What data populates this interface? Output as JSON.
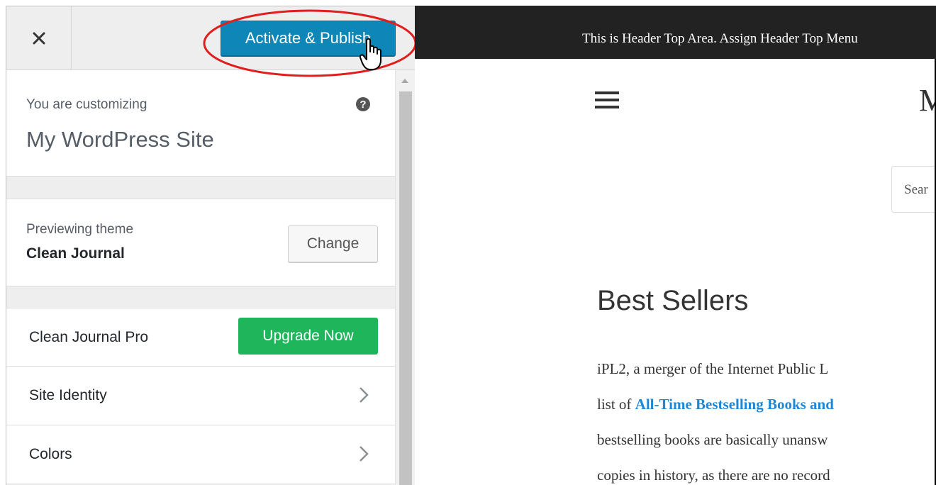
{
  "sidebar": {
    "close_icon": "close-icon",
    "publish_label": "Activate & Publish",
    "info": {
      "pre": "You are customizing",
      "title": "My WordPress Site",
      "help_icon": "help-icon"
    },
    "theme": {
      "pre": "Previewing theme",
      "name": "Clean Journal",
      "change_label": "Change"
    },
    "sections": [
      {
        "label": "Clean Journal Pro",
        "action_label": "Upgrade Now"
      },
      {
        "label": "Site Identity"
      },
      {
        "label": "Colors"
      }
    ],
    "colors": {
      "publish_blue": "#0e86b7",
      "upgrade_green": "#1fb55a",
      "highlight_red": "#e01e1e"
    }
  },
  "preview": {
    "top_bar_text": "This is Header Top Area. Assign Header Top Menu",
    "site_title_partial": "M",
    "search_placeholder_partial": "Sear",
    "article": {
      "title": "Best Sellers",
      "line1": "iPL2, a merger of the Internet Public L",
      "line2_prefix": "list of ",
      "line2_link": "All-Time Bestselling Books and",
      "line3": "bestselling books are basically unansw",
      "line4": "copies in history, as there are no record"
    }
  }
}
